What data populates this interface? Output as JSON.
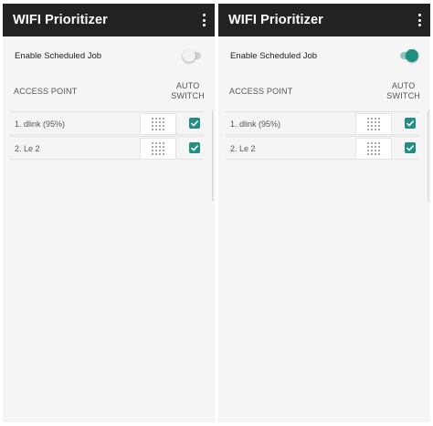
{
  "colors": {
    "appbar": "#222222",
    "accent": "#1e8f82",
    "background": "#f5f5f5"
  },
  "screens": [
    {
      "app_title": "WIFI Prioritizer",
      "menu_icon": "more-vert-icon",
      "scheduled_job": {
        "label": "Enable Scheduled Job",
        "enabled": false
      },
      "columns": {
        "access_point": "ACCESS POINT",
        "auto_switch_1": "AUTO",
        "auto_switch_2": "SWITCH"
      },
      "rows": [
        {
          "name": "1. dlink (95%)",
          "auto_switch": true
        },
        {
          "name": "2. Le 2",
          "auto_switch": true
        }
      ]
    },
    {
      "app_title": "WIFI Prioritizer",
      "menu_icon": "more-vert-icon",
      "scheduled_job": {
        "label": "Enable Scheduled Job",
        "enabled": true
      },
      "columns": {
        "access_point": "ACCESS POINT",
        "auto_switch_1": "AUTO",
        "auto_switch_2": "SWITCH"
      },
      "rows": [
        {
          "name": "1. dlink (95%)",
          "auto_switch": true
        },
        {
          "name": "2. Le 2",
          "auto_switch": true
        }
      ]
    }
  ]
}
